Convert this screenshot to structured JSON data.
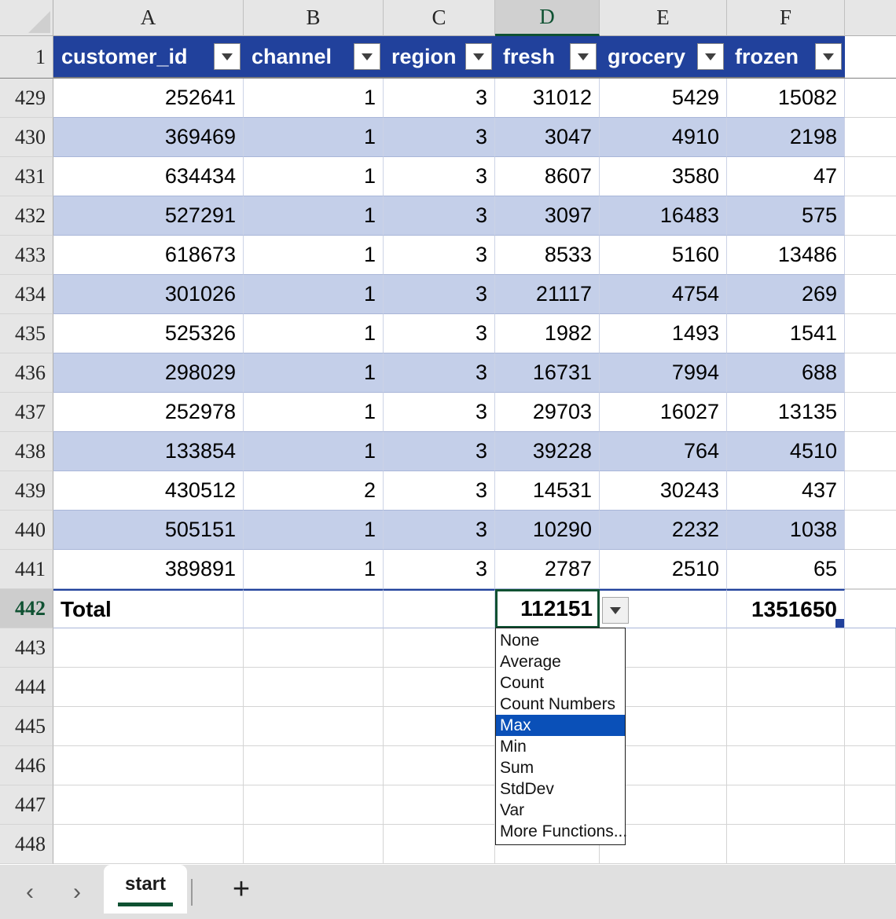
{
  "columns": {
    "letters": [
      "A",
      "B",
      "C",
      "D",
      "E",
      "F"
    ],
    "selected": "D"
  },
  "table": {
    "headers": [
      "customer_id",
      "channel",
      "region",
      "fresh",
      "grocery",
      "frozen"
    ],
    "row_numbers": [
      1,
      429,
      430,
      431,
      432,
      433,
      434,
      435,
      436,
      437,
      438,
      439,
      440,
      441,
      442,
      443,
      444,
      445,
      446,
      447,
      448
    ],
    "rows": [
      {
        "n": "429",
        "customer_id": "252641",
        "channel": "1",
        "region": "3",
        "fresh": "31012",
        "grocery": "5429",
        "frozen": "15082"
      },
      {
        "n": "430",
        "customer_id": "369469",
        "channel": "1",
        "region": "3",
        "fresh": "3047",
        "grocery": "4910",
        "frozen": "2198"
      },
      {
        "n": "431",
        "customer_id": "634434",
        "channel": "1",
        "region": "3",
        "fresh": "8607",
        "grocery": "3580",
        "frozen": "47"
      },
      {
        "n": "432",
        "customer_id": "527291",
        "channel": "1",
        "region": "3",
        "fresh": "3097",
        "grocery": "16483",
        "frozen": "575"
      },
      {
        "n": "433",
        "customer_id": "618673",
        "channel": "1",
        "region": "3",
        "fresh": "8533",
        "grocery": "5160",
        "frozen": "13486"
      },
      {
        "n": "434",
        "customer_id": "301026",
        "channel": "1",
        "region": "3",
        "fresh": "21117",
        "grocery": "4754",
        "frozen": "269"
      },
      {
        "n": "435",
        "customer_id": "525326",
        "channel": "1",
        "region": "3",
        "fresh": "1982",
        "grocery": "1493",
        "frozen": "1541"
      },
      {
        "n": "436",
        "customer_id": "298029",
        "channel": "1",
        "region": "3",
        "fresh": "16731",
        "grocery": "7994",
        "frozen": "688"
      },
      {
        "n": "437",
        "customer_id": "252978",
        "channel": "1",
        "region": "3",
        "fresh": "29703",
        "grocery": "16027",
        "frozen": "13135"
      },
      {
        "n": "438",
        "customer_id": "133854",
        "channel": "1",
        "region": "3",
        "fresh": "39228",
        "grocery": "764",
        "frozen": "4510"
      },
      {
        "n": "439",
        "customer_id": "430512",
        "channel": "2",
        "region": "3",
        "fresh": "14531",
        "grocery": "30243",
        "frozen": "437"
      },
      {
        "n": "440",
        "customer_id": "505151",
        "channel": "1",
        "region": "3",
        "fresh": "10290",
        "grocery": "2232",
        "frozen": "1038"
      },
      {
        "n": "441",
        "customer_id": "389891",
        "channel": "1",
        "region": "3",
        "fresh": "2787",
        "grocery": "2510",
        "frozen": "65"
      }
    ],
    "total_row": {
      "n": "442",
      "label": "Total",
      "channel": "",
      "region": "",
      "fresh": "112151",
      "grocery": "",
      "frozen": "1351650"
    },
    "empty_rows": [
      "443",
      "444",
      "445",
      "446",
      "447",
      "448"
    ]
  },
  "aggregate_menu": {
    "items": [
      "None",
      "Average",
      "Count",
      "Count Numbers",
      "Max",
      "Min",
      "Sum",
      "StdDev",
      "Var",
      "More Functions..."
    ],
    "selected": "Max"
  },
  "tabbar": {
    "prev_arrow": "‹",
    "next_arrow": "›",
    "sheets": [
      "start"
    ],
    "active_sheet": "start",
    "add_label": "+"
  },
  "colors": {
    "header_blue": "#21419c",
    "band_blue": "#c4cfe9",
    "selection_green": "#0f5132",
    "menu_highlight": "#0a50b8",
    "row_header_grey": "#e6e6e6"
  }
}
